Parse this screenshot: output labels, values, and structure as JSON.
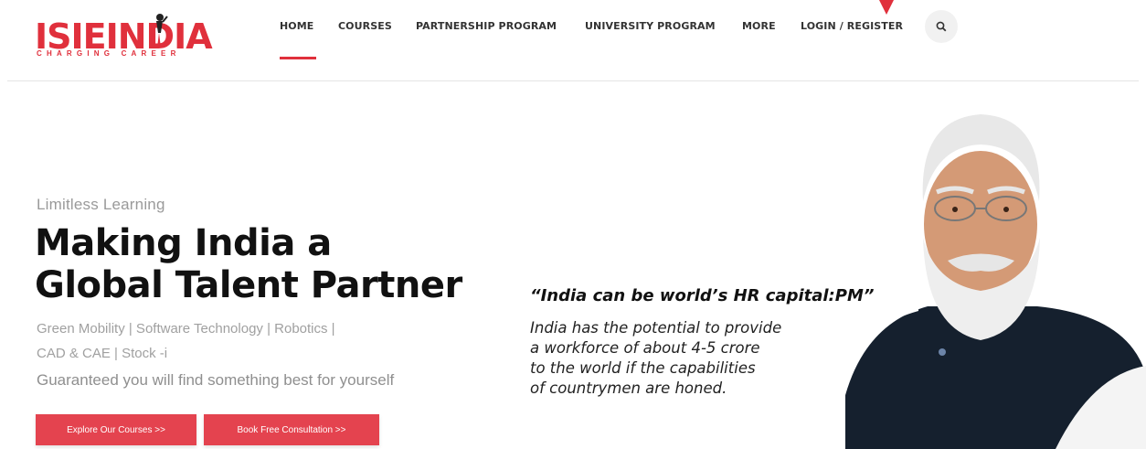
{
  "brand": {
    "name": "ISIEINDIA",
    "tagline": "CHARGING CAREER",
    "color": "#e0303c"
  },
  "nav": {
    "items": [
      {
        "label": "HOME",
        "active": true
      },
      {
        "label": "COURSES"
      },
      {
        "label": "PARTNERSHIP PROGRAM"
      },
      {
        "label": "UNIVERSITY PROGRAM"
      },
      {
        "label": "MORE"
      },
      {
        "label": "LOGIN / REGISTER"
      }
    ],
    "search_icon": "search-icon"
  },
  "hero": {
    "eyebrow": "Limitless Learning",
    "headline_line1": "Making India a",
    "headline_line2": "Global Talent Partner",
    "tags_line1": "Green Mobility | Software Technology | Robotics |",
    "tags_line2": "CAD & CAE | Stock -i",
    "tagline": "Guaranteed you will find something best for yourself",
    "buttons": {
      "explore": "Explore Our Courses >>",
      "consult": "Book Free Consultation >>"
    }
  },
  "quote": {
    "title": "“India can be world’s HR capital:PM”",
    "line1": "India has the potential to provide",
    "line2": "a workforce of about 4-5 crore",
    "line3": "to the world if the capabilities",
    "line4": "of countrymen are honed."
  },
  "colors": {
    "accent": "#e0303c",
    "button": "#e4434f"
  }
}
